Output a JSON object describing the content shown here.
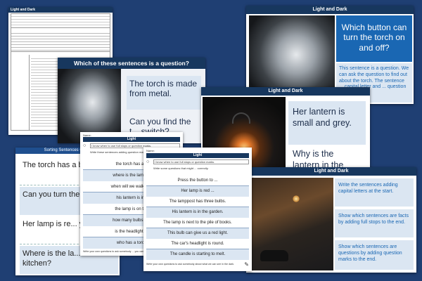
{
  "lesson_plan": {
    "title": "Light and Dark"
  },
  "slide_question": {
    "header": "Which of these sentences is a question?",
    "s1": "The torch is made from metal.",
    "s2": "Can you find the t... switch?"
  },
  "slide_button": {
    "header": "Light and Dark",
    "question": "Which button can turn the torch on and off?",
    "note": "This sentence is a question. We can ask the question to find out about the torch. The sentence ... capital letter and ... question mark."
  },
  "slide_lantern": {
    "header": "Light and Dark",
    "s1": "Her lantern is small and grey.",
    "s2": "Why is the lantern in the"
  },
  "slide_street": {
    "header": "Light and Dark",
    "b1": "Write the sentences adding capital letters at the start.",
    "b2": "Show which sentences are facts by adding full stops to the end.",
    "b3": "Show which sentences are questions by adding question marks to the end."
  },
  "sort_sheet": {
    "title": "Sorting Sentences Cards",
    "cards": [
      "The torch has a button.",
      "Can you turn the torch on?",
      "Her lamp is re... yellow.",
      "Where is the la... the kitchen?"
    ]
  },
  "worksheet1": {
    "name_label": "Name:",
    "title": "Light",
    "task1": "I know when to use full stops or question marks.",
    "task2": "Write these sentences adding question marks.",
    "rows": [
      "the torch has a b",
      "where is the lamp in",
      "when will we walk pas",
      "his lantern is in t",
      "the lamp is on top",
      "how many bulbs are",
      "is the headlight ru",
      "who has a torch"
    ],
    "footer": "Write your own questions to ask somebody ... you can see in the dark."
  },
  "worksheet2": {
    "name_label": "Name:",
    "title": "Light",
    "task1": "I know when to use full stops or question marks.",
    "task2": "Write some questions that might ... correctly.",
    "rows": [
      "Press the button to ...",
      "Her lamp is red ...",
      "The lamppost has three bulbs.",
      "His lantern is in the garden.",
      "The lamp is next to the pile of books.",
      "This bulb can give us a red light.",
      "The car's headlight is round.",
      "The candle is starting to melt."
    ],
    "footer": "Write your own questions to ask somebody about what we can see in the dark."
  },
  "colors": {
    "background": "#1f3f73",
    "header": "#17375e",
    "accent_blue": "#1a67b3",
    "pale_blue": "#dbe6f2"
  }
}
